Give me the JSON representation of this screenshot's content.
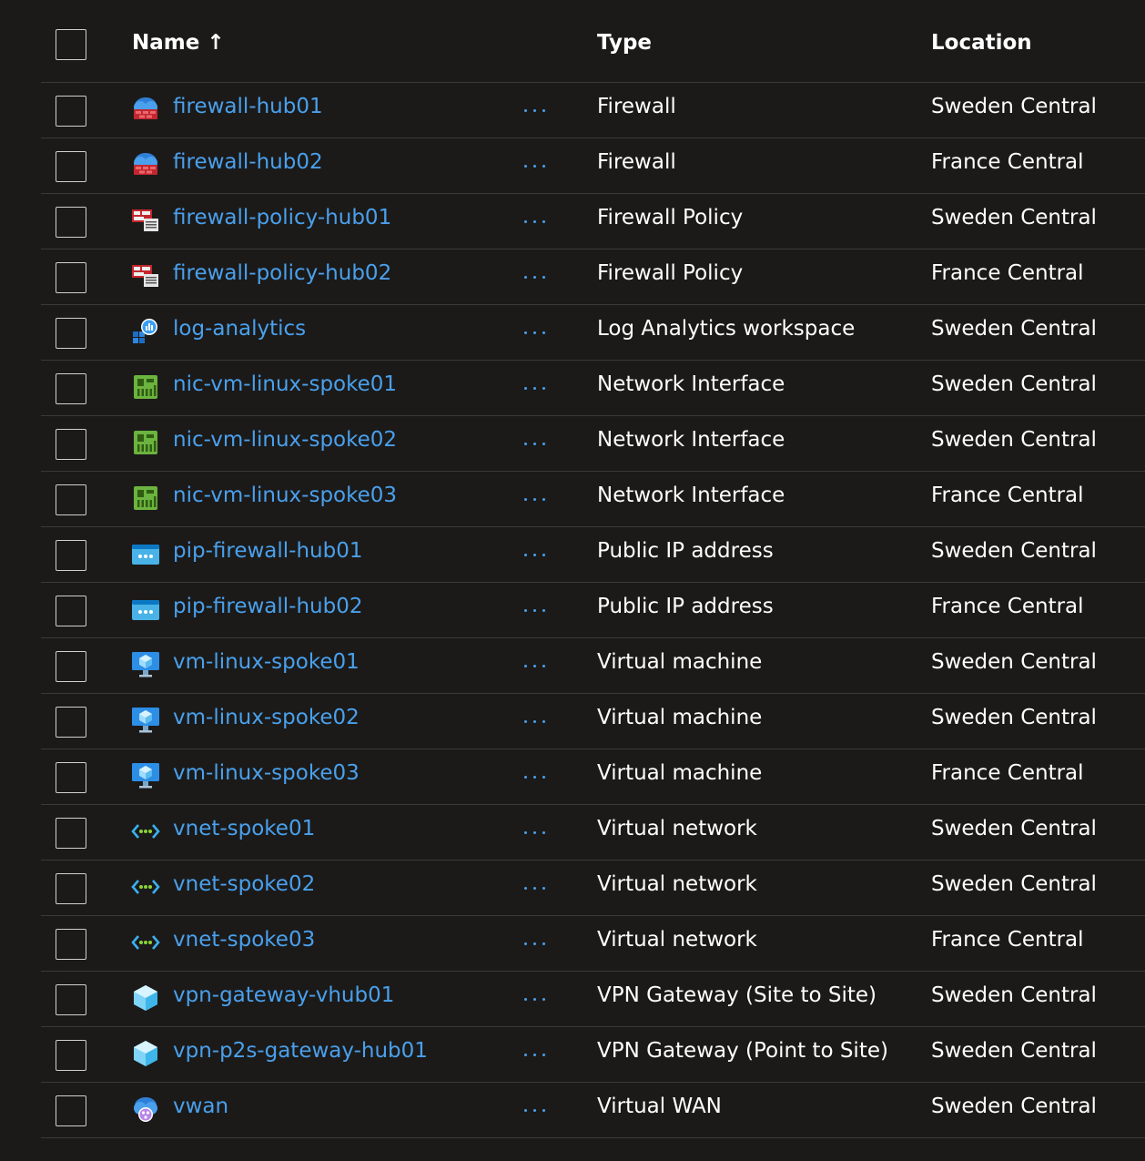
{
  "header": {
    "name_label": "Name ↑",
    "type_label": "Type",
    "location_label": "Location"
  },
  "colors": {
    "background": "#1b1a19",
    "link": "#4aa0ec",
    "divider": "#3b3a39"
  },
  "rows": [
    {
      "name": "firewall-hub01",
      "type": "Firewall",
      "location": "Sweden Central",
      "icon": "firewall-icon"
    },
    {
      "name": "firewall-hub02",
      "type": "Firewall",
      "location": "France Central",
      "icon": "firewall-icon"
    },
    {
      "name": "firewall-policy-hub01",
      "type": "Firewall Policy",
      "location": "Sweden Central",
      "icon": "firewall-policy-icon"
    },
    {
      "name": "firewall-policy-hub02",
      "type": "Firewall Policy",
      "location": "France Central",
      "icon": "firewall-policy-icon"
    },
    {
      "name": "log-analytics",
      "type": "Log Analytics workspace",
      "location": "Sweden Central",
      "icon": "log-analytics-icon"
    },
    {
      "name": "nic-vm-linux-spoke01",
      "type": "Network Interface",
      "location": "Sweden Central",
      "icon": "network-interface-icon"
    },
    {
      "name": "nic-vm-linux-spoke02",
      "type": "Network Interface",
      "location": "Sweden Central",
      "icon": "network-interface-icon"
    },
    {
      "name": "nic-vm-linux-spoke03",
      "type": "Network Interface",
      "location": "France Central",
      "icon": "network-interface-icon"
    },
    {
      "name": "pip-firewall-hub01",
      "type": "Public IP address",
      "location": "Sweden Central",
      "icon": "public-ip-icon"
    },
    {
      "name": "pip-firewall-hub02",
      "type": "Public IP address",
      "location": "France Central",
      "icon": "public-ip-icon"
    },
    {
      "name": "vm-linux-spoke01",
      "type": "Virtual machine",
      "location": "Sweden Central",
      "icon": "virtual-machine-icon"
    },
    {
      "name": "vm-linux-spoke02",
      "type": "Virtual machine",
      "location": "Sweden Central",
      "icon": "virtual-machine-icon"
    },
    {
      "name": "vm-linux-spoke03",
      "type": "Virtual machine",
      "location": "France Central",
      "icon": "virtual-machine-icon"
    },
    {
      "name": "vnet-spoke01",
      "type": "Virtual network",
      "location": "Sweden Central",
      "icon": "virtual-network-icon"
    },
    {
      "name": "vnet-spoke02",
      "type": "Virtual network",
      "location": "Sweden Central",
      "icon": "virtual-network-icon"
    },
    {
      "name": "vnet-spoke03",
      "type": "Virtual network",
      "location": "France Central",
      "icon": "virtual-network-icon"
    },
    {
      "name": "vpn-gateway-vhub01",
      "type": "VPN Gateway (Site to Site)",
      "location": "Sweden Central",
      "icon": "vpn-gateway-icon"
    },
    {
      "name": "vpn-p2s-gateway-hub01",
      "type": "VPN Gateway (Point to Site)",
      "location": "Sweden Central",
      "icon": "vpn-gateway-icon"
    },
    {
      "name": "vwan",
      "type": "Virtual WAN",
      "location": "Sweden Central",
      "icon": "virtual-wan-icon"
    }
  ]
}
